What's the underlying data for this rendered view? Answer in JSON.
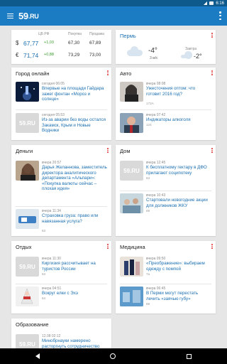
{
  "status": {
    "time": "6:16"
  },
  "app": {
    "logo": "59",
    "logo_suffix": ".RU"
  },
  "currency": {
    "headers": {
      "cb": "ЦБ РФ",
      "buy": "Покупка",
      "sell": "Продажа"
    },
    "rows": [
      {
        "symbol": "$",
        "value": "67,77",
        "change": "+1,03",
        "buy": "67,30",
        "sell": "67,89"
      },
      {
        "symbol": "€",
        "value": "71,74",
        "change": "+0,88",
        "buy": "73,29",
        "sell": "73,00"
      }
    ]
  },
  "weather": {
    "city": "Пермь",
    "now_temp": "-4°",
    "wind": "3 м/с",
    "tomorrow_label": "Завтра",
    "tomorrow_temp": "-2°"
  },
  "sections": {
    "city": {
      "title": "Город онлайн",
      "items": [
        {
          "meta": "сегодня 06:05",
          "title": "Впервые на площади Гайдара зажег фонтан «Мороз и солнце»",
          "count": ""
        },
        {
          "meta": "сегодня 05:53",
          "title": "Из-за аварии без воды остался Закамск, Крым и Новые Водники",
          "count": ""
        }
      ]
    },
    "auto": {
      "title": "Авто",
      "items": [
        {
          "meta": "вчера 08:08",
          "title": "Ужесточения оптом: что готовит 2016 год?",
          "count": "172А"
        },
        {
          "meta": "вчера 07:42",
          "title": "Индикаторы алкоголя",
          "count": "124"
        }
      ]
    },
    "money": {
      "title": "Деньги",
      "items": [
        {
          "meta": "вчера 20:57",
          "title": "Дарья Желаннова, заместитель директора аналитического департамента «Альпари»: «Покупка валюты сейчас – плохая идея»",
          "count": ""
        },
        {
          "meta": "вчера 11:34",
          "title": "Страховка груза: право или навязанная услуга?",
          "count": "63"
        }
      ]
    },
    "home": {
      "title": "Дом",
      "items": [
        {
          "meta": "вчера 12:45",
          "title": "К бесплатному гектару в ДФО прилагают соципотеку",
          "count": "63"
        },
        {
          "meta": "вчера 10:43",
          "title": "Стартовали новогодние акции для должников ЖКУ",
          "count": "69"
        }
      ]
    },
    "rest": {
      "title": "Отдых",
      "items": [
        {
          "meta": "вчера 11:30",
          "title": "Киргизия рассчитывает на туристов России",
          "count": "63"
        },
        {
          "meta": "вчера 04:51",
          "title": "Вокруг елки с Эхэ",
          "count": "64"
        }
      ]
    },
    "medicine": {
      "title": "Медицина",
      "items": [
        {
          "meta": "вчера 09:50",
          "title": "«Преображение»: выбираем одежду с помпой",
          "count": "7а"
        },
        {
          "meta": "вчера 06:45",
          "title": "В Перми могут перестать лечить «заячью губу»",
          "count": "69"
        }
      ]
    },
    "education": {
      "title": "Образование",
      "items": [
        {
          "meta": "12.08 02:12",
          "title": "Минобрнауки намерено расторгнуть сотрудничество",
          "count": ""
        }
      ]
    }
  },
  "placeholder_logo": "59.RU",
  "colors": {
    "appbar": "#1b7cc4",
    "statusbar": "#0f5a8c",
    "link": "#1b6fb0",
    "kebab": "#e0413f",
    "positive": "#3a9a2b"
  }
}
